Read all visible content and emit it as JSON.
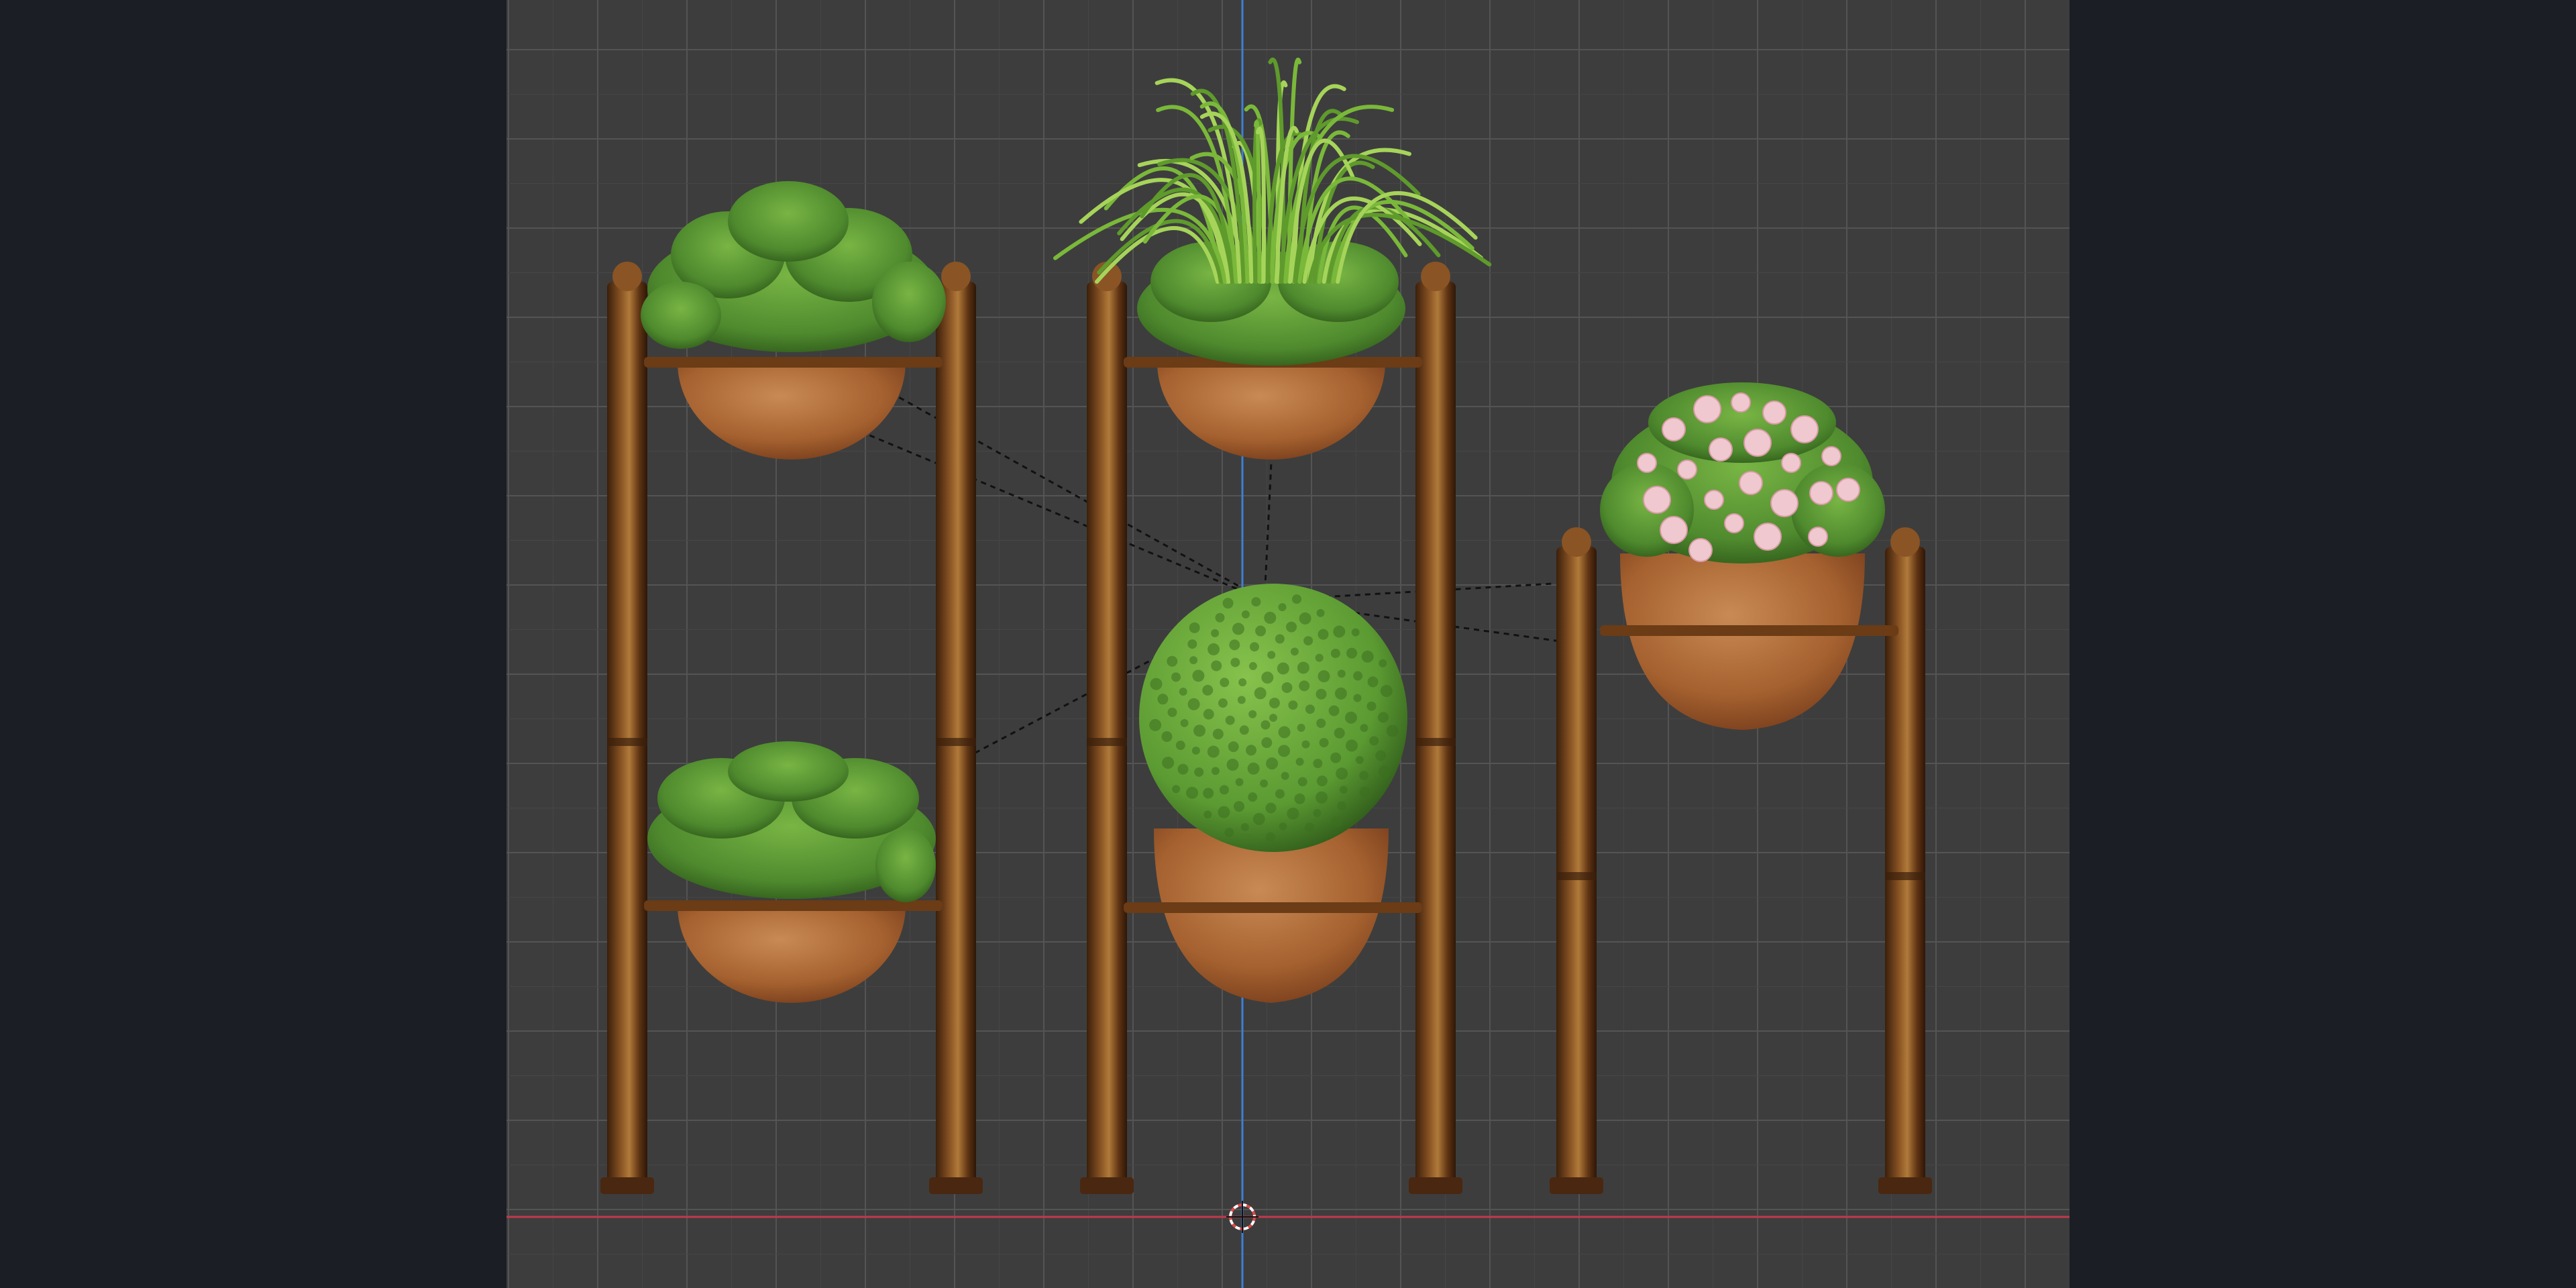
{
  "viewport": {
    "background_color": "#3d3d3d",
    "grid": true,
    "grid_minor_color": "#464646",
    "grid_major_color": "#545454",
    "y_axis_color": "#3f7fd4",
    "x_axis_color": "#c2394c",
    "relationship_line_style": "dashed-black",
    "cursor_color": "#e04a4a",
    "side_panel_color": "#1b1e25"
  },
  "scene": {
    "stand_material_color": "#6b3c16",
    "stand_highlight_color": "#b07a3a",
    "pot_color": "#b26a3a",
    "pot_shadow_color": "#7a3f1d",
    "foliage_color": "#4f8a2e",
    "foliage_dark_color": "#2f5a1a",
    "grass_color": "#7ab83a",
    "flower_color": "#f0c8cf",
    "objects": [
      {
        "name": "left-stand",
        "plants": [
          "ivy-bush-top",
          "ivy-bush-bottom"
        ]
      },
      {
        "name": "center-stand",
        "plants": [
          "ornamental-grass-top",
          "boxwood-sphere-bottom"
        ]
      },
      {
        "name": "right-stand",
        "plants": [
          "pink-rose-bush"
        ]
      }
    ]
  }
}
